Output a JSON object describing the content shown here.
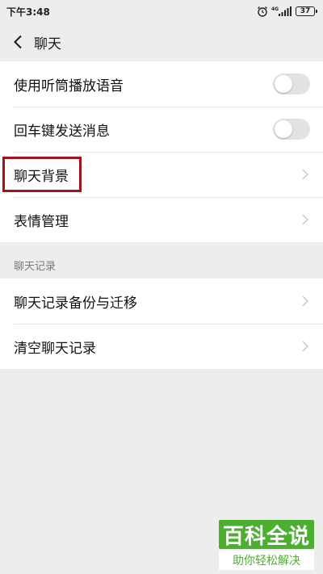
{
  "status_bar": {
    "time": "下午3:48",
    "network": "4G",
    "battery": "37"
  },
  "nav": {
    "title": "聊天"
  },
  "settings": {
    "group1": [
      {
        "label": "使用听筒播放语音",
        "control": "toggle",
        "on": false
      },
      {
        "label": "回车键发送消息",
        "control": "toggle",
        "on": false
      },
      {
        "label": "聊天背景",
        "control": "chevron",
        "highlighted": true
      },
      {
        "label": "表情管理",
        "control": "chevron"
      }
    ],
    "section_header": "聊天记录",
    "group2": [
      {
        "label": "聊天记录备份与迁移",
        "control": "chevron"
      },
      {
        "label": "清空聊天记录",
        "control": "chevron"
      }
    ]
  },
  "watermark": {
    "title": "百科全说",
    "subtitle": "助你轻松解决"
  },
  "colors": {
    "background": "#ededed",
    "highlight_border": "#a1151a",
    "watermark_green": "#4caf2f"
  }
}
